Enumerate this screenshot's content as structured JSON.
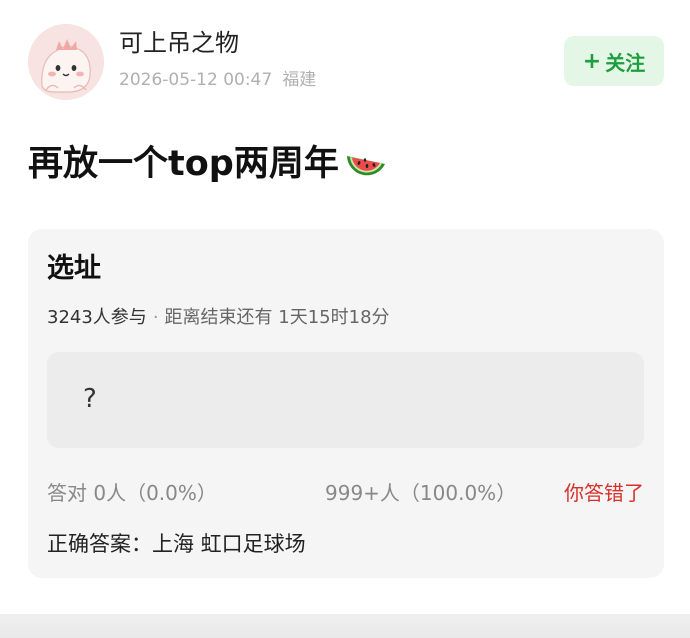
{
  "header": {
    "username": "可上吊之物",
    "datetime": "2026-05-12 00:47",
    "location": "福建",
    "follow_label": "关注",
    "follow_plus": "+"
  },
  "post": {
    "title": "再放一个top两周年",
    "emoji": "watermelon-icon"
  },
  "quiz": {
    "title": "选址",
    "participants": "3243人参与",
    "separator": "·",
    "deadline": "距离结束还有 1天15时18分",
    "option_label": "?",
    "correct_count": "答对  0人（0.0%）",
    "wrong_count": "999+人（100.0%）",
    "wrong_tag": "你答错了",
    "answer": "正确答案：上海 虹口足球场"
  },
  "colors": {
    "follow_bg": "#e4f7e7",
    "follow_text": "#1e9e3e",
    "wrong_tag": "#d8302a",
    "card_bg": "#f5f5f5"
  }
}
